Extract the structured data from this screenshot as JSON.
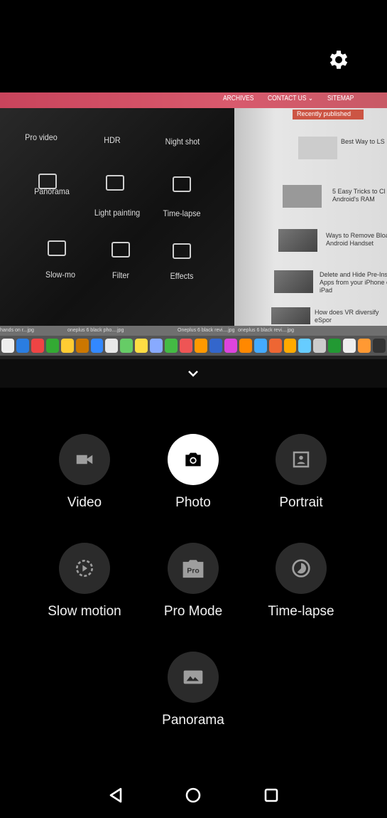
{
  "top": {
    "settings_icon": "gear-icon"
  },
  "viewfinder": {
    "site_nav": [
      "ARCHIVES",
      "CONTACT US ⌄",
      "SITEMAP"
    ],
    "site_sidebar_heading": "Recently published",
    "articles": [
      "Best Way to LS Process",
      "5 Easy Tricks to Cl Android's RAM",
      "Ways to Remove Bloa from Android Handset",
      "Delete and Hide Pre-Insta Apps from your iPhone or iPad",
      "How does VR diversify eSpor"
    ],
    "screen_modes": [
      "Pro video",
      "HDR",
      "Night shot",
      "Panorama",
      "Light painting",
      "Time-lapse",
      "Slow-mo",
      "Filter",
      "Effects"
    ],
    "tabs": [
      "hands on r...jpg",
      "oneplus 6 black pho....jpg",
      "Oneplus 6 black revi....jpg",
      "oneplus 6 black revi....jpg"
    ]
  },
  "collapse_icon": "chevron-down-icon",
  "modes": [
    {
      "label": "Video",
      "icon": "videocam-icon",
      "selected": false
    },
    {
      "label": "Photo",
      "icon": "camera-icon",
      "selected": true
    },
    {
      "label": "Portrait",
      "icon": "portrait-icon",
      "selected": false
    },
    {
      "label": "Slow motion",
      "icon": "slow-motion-icon",
      "selected": false
    },
    {
      "label": "Pro Mode",
      "icon": "pro-icon",
      "icon_text": "Pro",
      "selected": false
    },
    {
      "label": "Time-lapse",
      "icon": "timelapse-icon",
      "selected": false
    },
    {
      "label": "Panorama",
      "icon": "panorama-icon",
      "selected": false
    }
  ],
  "navbar": [
    "back",
    "home",
    "recents"
  ],
  "colors": {
    "selected_circle": "#ffffff",
    "mode_circle": "#2b2b2b",
    "icon_grey": "#9e9e9e"
  }
}
